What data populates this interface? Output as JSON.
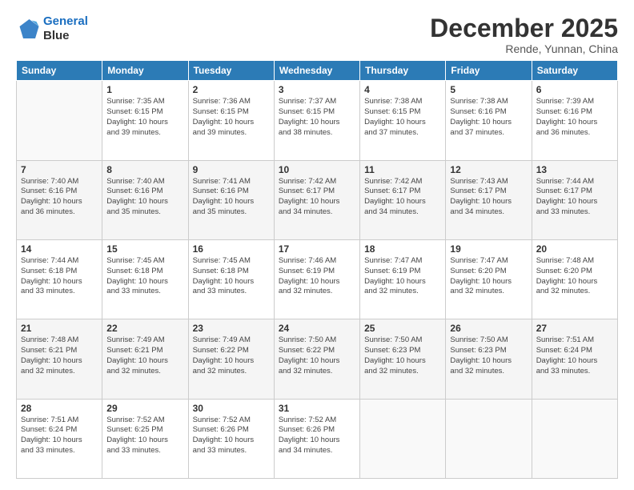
{
  "header": {
    "logo_line1": "General",
    "logo_line2": "Blue",
    "title": "December 2025",
    "subtitle": "Rende, Yunnan, China"
  },
  "weekdays": [
    "Sunday",
    "Monday",
    "Tuesday",
    "Wednesday",
    "Thursday",
    "Friday",
    "Saturday"
  ],
  "weeks": [
    [
      {
        "day": "",
        "info": ""
      },
      {
        "day": "1",
        "info": "Sunrise: 7:35 AM\nSunset: 6:15 PM\nDaylight: 10 hours\nand 39 minutes."
      },
      {
        "day": "2",
        "info": "Sunrise: 7:36 AM\nSunset: 6:15 PM\nDaylight: 10 hours\nand 39 minutes."
      },
      {
        "day": "3",
        "info": "Sunrise: 7:37 AM\nSunset: 6:15 PM\nDaylight: 10 hours\nand 38 minutes."
      },
      {
        "day": "4",
        "info": "Sunrise: 7:38 AM\nSunset: 6:15 PM\nDaylight: 10 hours\nand 37 minutes."
      },
      {
        "day": "5",
        "info": "Sunrise: 7:38 AM\nSunset: 6:16 PM\nDaylight: 10 hours\nand 37 minutes."
      },
      {
        "day": "6",
        "info": "Sunrise: 7:39 AM\nSunset: 6:16 PM\nDaylight: 10 hours\nand 36 minutes."
      }
    ],
    [
      {
        "day": "7",
        "info": "Sunrise: 7:40 AM\nSunset: 6:16 PM\nDaylight: 10 hours\nand 36 minutes."
      },
      {
        "day": "8",
        "info": "Sunrise: 7:40 AM\nSunset: 6:16 PM\nDaylight: 10 hours\nand 35 minutes."
      },
      {
        "day": "9",
        "info": "Sunrise: 7:41 AM\nSunset: 6:16 PM\nDaylight: 10 hours\nand 35 minutes."
      },
      {
        "day": "10",
        "info": "Sunrise: 7:42 AM\nSunset: 6:17 PM\nDaylight: 10 hours\nand 34 minutes."
      },
      {
        "day": "11",
        "info": "Sunrise: 7:42 AM\nSunset: 6:17 PM\nDaylight: 10 hours\nand 34 minutes."
      },
      {
        "day": "12",
        "info": "Sunrise: 7:43 AM\nSunset: 6:17 PM\nDaylight: 10 hours\nand 34 minutes."
      },
      {
        "day": "13",
        "info": "Sunrise: 7:44 AM\nSunset: 6:17 PM\nDaylight: 10 hours\nand 33 minutes."
      }
    ],
    [
      {
        "day": "14",
        "info": "Sunrise: 7:44 AM\nSunset: 6:18 PM\nDaylight: 10 hours\nand 33 minutes."
      },
      {
        "day": "15",
        "info": "Sunrise: 7:45 AM\nSunset: 6:18 PM\nDaylight: 10 hours\nand 33 minutes."
      },
      {
        "day": "16",
        "info": "Sunrise: 7:45 AM\nSunset: 6:18 PM\nDaylight: 10 hours\nand 33 minutes."
      },
      {
        "day": "17",
        "info": "Sunrise: 7:46 AM\nSunset: 6:19 PM\nDaylight: 10 hours\nand 32 minutes."
      },
      {
        "day": "18",
        "info": "Sunrise: 7:47 AM\nSunset: 6:19 PM\nDaylight: 10 hours\nand 32 minutes."
      },
      {
        "day": "19",
        "info": "Sunrise: 7:47 AM\nSunset: 6:20 PM\nDaylight: 10 hours\nand 32 minutes."
      },
      {
        "day": "20",
        "info": "Sunrise: 7:48 AM\nSunset: 6:20 PM\nDaylight: 10 hours\nand 32 minutes."
      }
    ],
    [
      {
        "day": "21",
        "info": "Sunrise: 7:48 AM\nSunset: 6:21 PM\nDaylight: 10 hours\nand 32 minutes."
      },
      {
        "day": "22",
        "info": "Sunrise: 7:49 AM\nSunset: 6:21 PM\nDaylight: 10 hours\nand 32 minutes."
      },
      {
        "day": "23",
        "info": "Sunrise: 7:49 AM\nSunset: 6:22 PM\nDaylight: 10 hours\nand 32 minutes."
      },
      {
        "day": "24",
        "info": "Sunrise: 7:50 AM\nSunset: 6:22 PM\nDaylight: 10 hours\nand 32 minutes."
      },
      {
        "day": "25",
        "info": "Sunrise: 7:50 AM\nSunset: 6:23 PM\nDaylight: 10 hours\nand 32 minutes."
      },
      {
        "day": "26",
        "info": "Sunrise: 7:50 AM\nSunset: 6:23 PM\nDaylight: 10 hours\nand 32 minutes."
      },
      {
        "day": "27",
        "info": "Sunrise: 7:51 AM\nSunset: 6:24 PM\nDaylight: 10 hours\nand 33 minutes."
      }
    ],
    [
      {
        "day": "28",
        "info": "Sunrise: 7:51 AM\nSunset: 6:24 PM\nDaylight: 10 hours\nand 33 minutes."
      },
      {
        "day": "29",
        "info": "Sunrise: 7:52 AM\nSunset: 6:25 PM\nDaylight: 10 hours\nand 33 minutes."
      },
      {
        "day": "30",
        "info": "Sunrise: 7:52 AM\nSunset: 6:26 PM\nDaylight: 10 hours\nand 33 minutes."
      },
      {
        "day": "31",
        "info": "Sunrise: 7:52 AM\nSunset: 6:26 PM\nDaylight: 10 hours\nand 34 minutes."
      },
      {
        "day": "",
        "info": ""
      },
      {
        "day": "",
        "info": ""
      },
      {
        "day": "",
        "info": ""
      }
    ]
  ]
}
